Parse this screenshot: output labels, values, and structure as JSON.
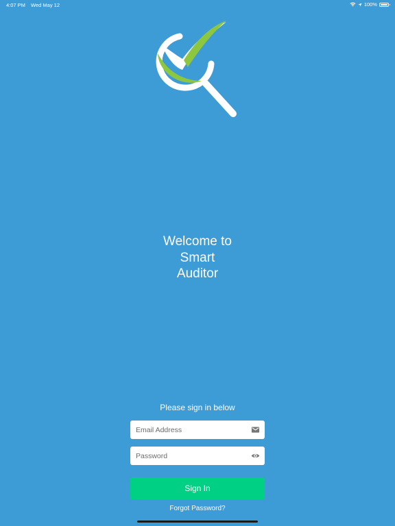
{
  "status_bar": {
    "time": "4:07 PM",
    "date": "Wed May 12",
    "battery_text": "100%",
    "battery_level": 1.0,
    "icons": [
      "wifi-icon",
      "location-icon",
      "battery-icon"
    ]
  },
  "logo": {
    "icon": "magnifier-checkmark-logo",
    "colors": {
      "green": "#8dc63f",
      "white": "#ffffff"
    }
  },
  "welcome": {
    "line1": "Welcome to",
    "line2": "Smart",
    "line3": "Auditor"
  },
  "signin": {
    "prompt": "Please sign in below",
    "email_placeholder": "Email Address",
    "email_value": "",
    "password_placeholder": "Password",
    "password_value": "",
    "button_label": "Sign In",
    "forgot_label": "Forgot Password?"
  },
  "colors": {
    "background": "#3d9bd6",
    "button": "#00d084",
    "field": "#ffffff",
    "icon_gray": "#777777"
  }
}
